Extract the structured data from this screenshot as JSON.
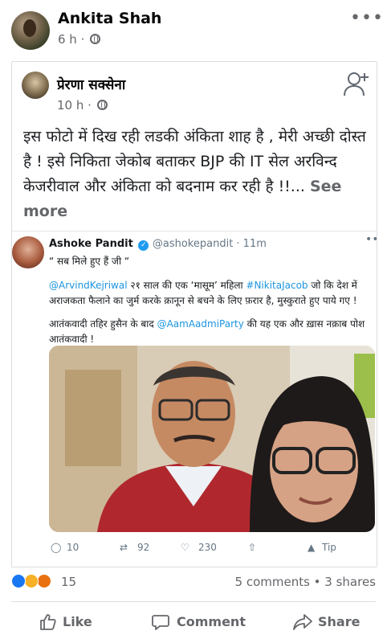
{
  "post": {
    "author": "Ankita Shah",
    "time": "6 h ·"
  },
  "shared": {
    "author": "प्रेरणा सक्सेना",
    "time": "10 h ·",
    "text": "इस फोटो में दिख रही लडकी अंकिता शाह है , मेरी अच्छी दोस्त है ! इसे निकिता जेकोब बताकर BJP की IT सेल अरविन्द केजरीवाल और अंकिता  को बदनाम कर रही है !!...",
    "see_more": "See more"
  },
  "tweet": {
    "name": "Ashoke Pandit",
    "verified_mark": "✓",
    "handle": "@ashokepandit · 11m",
    "quote": "“ सब मिले हुए हैं जी “",
    "line1_mention": "@ArvindKejriwal",
    "line1_text_a": " २१ साल की एक ‘मासूम’ महिला ",
    "line1_hashtag": "#NikitaJacob",
    "line1_text_b": " जो कि देश में अराजकता फैलाने का जुर्म करके क़ानून से बचने के लिए फ़रार है, मुस्कुराते हुए पाये गए !",
    "line2_text_a": "आतंकवादी तहिर हुसैन के बाद ",
    "line2_mention": "@AamAadmiParty",
    "line2_text_b": " की यह एक और ख़ास नक़ाब पोश आतंकवादी !",
    "replies": "10",
    "retweets": "92",
    "likes": "230",
    "tip": "Tip"
  },
  "stats": {
    "reactions_count": "15",
    "comments_shares": "5 comments • 3 shares"
  },
  "actions": {
    "like": "Like",
    "comment": "Comment",
    "share": "Share"
  },
  "colors": {
    "link_blue": "#1b95e0",
    "like_blue": "#1877f2",
    "haha_yellow": "#f7b125",
    "angry_red": "#e9710f"
  }
}
